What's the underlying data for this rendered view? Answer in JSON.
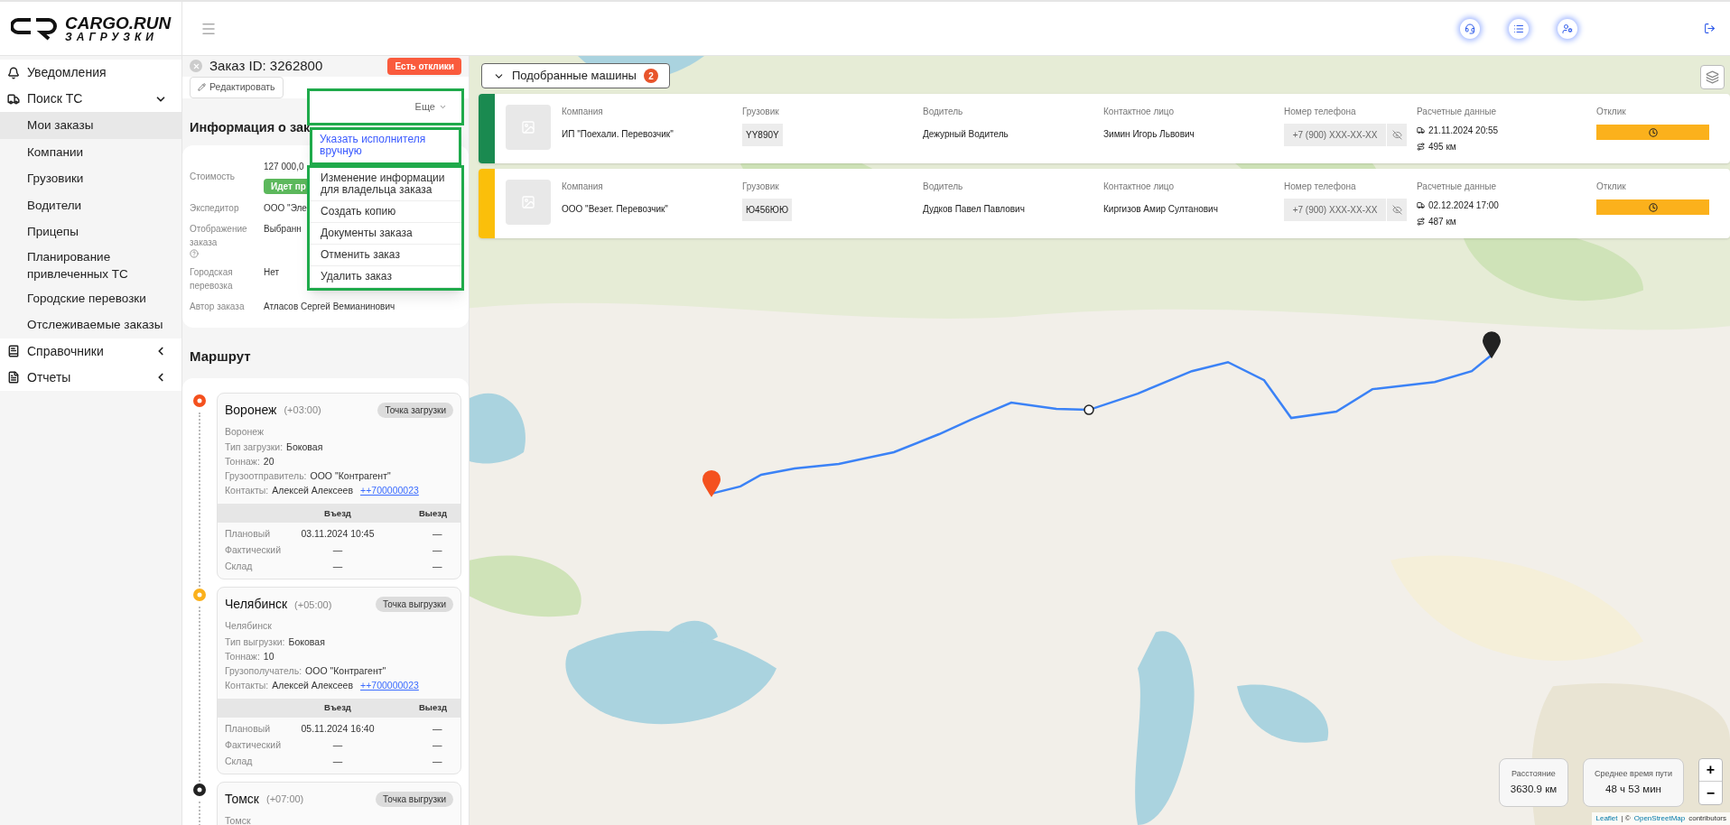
{
  "logo": {
    "title": "CARGO.RUN",
    "subtitle": "ЗАГРУЗКИ"
  },
  "sidebar": {
    "items": [
      {
        "label": "Уведомления",
        "kind": "link"
      },
      {
        "label": "Поиск ТС",
        "kind": "group",
        "expanded": true,
        "children": [
          {
            "label": "Мои заказы",
            "selected": true
          },
          {
            "label": "Компании",
            "selected": false
          },
          {
            "label": "Грузовики",
            "selected": false
          },
          {
            "label": "Водители",
            "selected": false
          },
          {
            "label": "Прицепы",
            "selected": false
          },
          {
            "label": "Планирование привлеченных ТС",
            "selected": false
          },
          {
            "label": "Городские перевозки",
            "selected": false
          },
          {
            "label": "Отслеживаемые заказы",
            "selected": false
          }
        ]
      },
      {
        "label": "Справочники",
        "kind": "group",
        "expanded": false
      },
      {
        "label": "Отчеты",
        "kind": "group",
        "expanded": false
      }
    ]
  },
  "order": {
    "title": "Заказ ID: 3262800",
    "badge": "Есть отклики",
    "edit_button": "Редактировать",
    "more_button": "Еще",
    "info_title": "Информация о зак",
    "fields": [
      {
        "label": "Стоимость",
        "value": "127 000,0",
        "status": "Идет пр"
      },
      {
        "label": "Экспедитор",
        "value": "ООО \"Эле"
      },
      {
        "label": "Отображение заказа",
        "value": "Выбранн",
        "help": true
      },
      {
        "label": "Городская перевозка",
        "value": "Нет"
      },
      {
        "label": "Автор заказа",
        "value": "Атласов Сергей Вемианинович"
      }
    ]
  },
  "menu": {
    "items": [
      {
        "label": "Указать исполнителя вручную",
        "selected": true
      },
      {
        "label": "Изменение информации для владельца заказа",
        "selected": false
      },
      {
        "label": "Создать копию",
        "selected": false
      },
      {
        "label": "Документы заказа",
        "selected": false
      },
      {
        "label": "Отменить заказ",
        "selected": false
      },
      {
        "label": "Удалить заказ",
        "selected": false
      }
    ]
  },
  "route": {
    "title": "Маршрут",
    "points": [
      {
        "city": "Воронеж",
        "tz": "(+03:00)",
        "type": "Точка загрузки",
        "color": "#f4511e",
        "address": "Воронеж",
        "lines": [
          {
            "label": "Тип загрузки:",
            "value": "Боковая"
          },
          {
            "label": "Тоннаж:",
            "value": "20"
          },
          {
            "label": "Грузоотправитель:",
            "value": "ООО \"Контрагент\""
          },
          {
            "label": "Контакты:",
            "value": "Алексей Алексеев",
            "link": "++700000023"
          }
        ],
        "table": {
          "columns": [
            "",
            "Въезд",
            "Выезд"
          ],
          "rows": [
            [
              "Плановый",
              "03.11.2024 10:45",
              "—"
            ],
            [
              "Фактический",
              "—",
              "—"
            ],
            [
              "Склад",
              "—",
              "—"
            ]
          ]
        }
      },
      {
        "city": "Челябинск",
        "tz": "(+05:00)",
        "type": "Точка выгрузки",
        "color": "#fbb11c",
        "address": "Челябинск",
        "lines": [
          {
            "label": "Тип выгрузки:",
            "value": "Боковая"
          },
          {
            "label": "Тоннаж:",
            "value": "10"
          },
          {
            "label": "Грузополучатель:",
            "value": "ООО \"Контрагент\""
          },
          {
            "label": "Контакты:",
            "value": "Алексей Алексеев",
            "link": "++700000023"
          }
        ],
        "table": {
          "columns": [
            "",
            "Въезд",
            "Выезд"
          ],
          "rows": [
            [
              "Плановый",
              "05.11.2024 16:40",
              "—"
            ],
            [
              "Фактический",
              "—",
              "—"
            ],
            [
              "Склад",
              "—",
              "—"
            ]
          ]
        }
      },
      {
        "city": "Томск",
        "tz": "(+07:00)",
        "type": "Точка выгрузки",
        "color": "#222222",
        "address": "Томск"
      }
    ]
  },
  "matches": {
    "label": "Подобранные машины",
    "count": "2"
  },
  "vehicles": [
    {
      "color": "#1a8a50",
      "labels": [
        "Компания",
        "Грузовик",
        "Водитель",
        "Контактное лицо",
        "Номер телефона",
        "Расчетные данные",
        "Отклик"
      ],
      "company": "ИП \"Поехали. Перевозчик\"",
      "truck": "YY890Y",
      "driver": "Дежурный Водитель",
      "contact": "Зимин Игорь Львович",
      "phone": "+7 (900) XXX-XX-XX",
      "date": "21.11.2024 20:55",
      "distance": "495 км"
    },
    {
      "color": "#fbbf0a",
      "labels": [
        "Компания",
        "Грузовик",
        "Водитель",
        "Контактное лицо",
        "Номер телефона",
        "Расчетные данные",
        "Отклик"
      ],
      "company": "ООО \"Везет. Перевозчик\"",
      "truck": "Ю456ЮЮ",
      "driver": "Дудков Павел Павлович",
      "contact": "Киргизов Амир Султанович",
      "phone": "+7 (900) XXX-XX-XX",
      "date": "02.12.2024 17:00",
      "distance": "487 км"
    }
  ],
  "map": {
    "stats": [
      {
        "label": "Расстояние",
        "value": "3630.9 км"
      },
      {
        "label": "Среднее время пути",
        "value": "48 ч 53 мин"
      }
    ],
    "zoom_in": "+",
    "zoom_out": "−",
    "attribution": {
      "leaflet": "Leaflet",
      "separator": "| ©",
      "osm": "OpenStreetMap",
      "suffix": "contributors"
    }
  }
}
